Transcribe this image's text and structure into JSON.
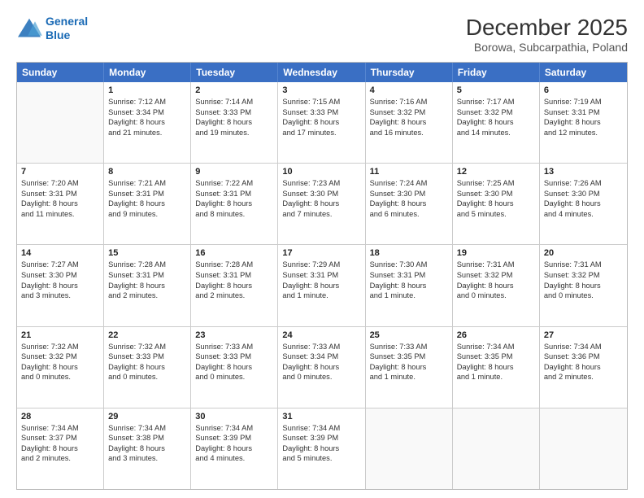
{
  "logo": {
    "line1": "General",
    "line2": "Blue"
  },
  "header": {
    "month": "December 2025",
    "location": "Borowa, Subcarpathia, Poland"
  },
  "weekdays": [
    "Sunday",
    "Monday",
    "Tuesday",
    "Wednesday",
    "Thursday",
    "Friday",
    "Saturday"
  ],
  "rows": [
    [
      {
        "day": "",
        "lines": []
      },
      {
        "day": "1",
        "lines": [
          "Sunrise: 7:12 AM",
          "Sunset: 3:34 PM",
          "Daylight: 8 hours",
          "and 21 minutes."
        ]
      },
      {
        "day": "2",
        "lines": [
          "Sunrise: 7:14 AM",
          "Sunset: 3:33 PM",
          "Daylight: 8 hours",
          "and 19 minutes."
        ]
      },
      {
        "day": "3",
        "lines": [
          "Sunrise: 7:15 AM",
          "Sunset: 3:33 PM",
          "Daylight: 8 hours",
          "and 17 minutes."
        ]
      },
      {
        "day": "4",
        "lines": [
          "Sunrise: 7:16 AM",
          "Sunset: 3:32 PM",
          "Daylight: 8 hours",
          "and 16 minutes."
        ]
      },
      {
        "day": "5",
        "lines": [
          "Sunrise: 7:17 AM",
          "Sunset: 3:32 PM",
          "Daylight: 8 hours",
          "and 14 minutes."
        ]
      },
      {
        "day": "6",
        "lines": [
          "Sunrise: 7:19 AM",
          "Sunset: 3:31 PM",
          "Daylight: 8 hours",
          "and 12 minutes."
        ]
      }
    ],
    [
      {
        "day": "7",
        "lines": [
          "Sunrise: 7:20 AM",
          "Sunset: 3:31 PM",
          "Daylight: 8 hours",
          "and 11 minutes."
        ]
      },
      {
        "day": "8",
        "lines": [
          "Sunrise: 7:21 AM",
          "Sunset: 3:31 PM",
          "Daylight: 8 hours",
          "and 9 minutes."
        ]
      },
      {
        "day": "9",
        "lines": [
          "Sunrise: 7:22 AM",
          "Sunset: 3:31 PM",
          "Daylight: 8 hours",
          "and 8 minutes."
        ]
      },
      {
        "day": "10",
        "lines": [
          "Sunrise: 7:23 AM",
          "Sunset: 3:30 PM",
          "Daylight: 8 hours",
          "and 7 minutes."
        ]
      },
      {
        "day": "11",
        "lines": [
          "Sunrise: 7:24 AM",
          "Sunset: 3:30 PM",
          "Daylight: 8 hours",
          "and 6 minutes."
        ]
      },
      {
        "day": "12",
        "lines": [
          "Sunrise: 7:25 AM",
          "Sunset: 3:30 PM",
          "Daylight: 8 hours",
          "and 5 minutes."
        ]
      },
      {
        "day": "13",
        "lines": [
          "Sunrise: 7:26 AM",
          "Sunset: 3:30 PM",
          "Daylight: 8 hours",
          "and 4 minutes."
        ]
      }
    ],
    [
      {
        "day": "14",
        "lines": [
          "Sunrise: 7:27 AM",
          "Sunset: 3:30 PM",
          "Daylight: 8 hours",
          "and 3 minutes."
        ]
      },
      {
        "day": "15",
        "lines": [
          "Sunrise: 7:28 AM",
          "Sunset: 3:31 PM",
          "Daylight: 8 hours",
          "and 2 minutes."
        ]
      },
      {
        "day": "16",
        "lines": [
          "Sunrise: 7:28 AM",
          "Sunset: 3:31 PM",
          "Daylight: 8 hours",
          "and 2 minutes."
        ]
      },
      {
        "day": "17",
        "lines": [
          "Sunrise: 7:29 AM",
          "Sunset: 3:31 PM",
          "Daylight: 8 hours",
          "and 1 minute."
        ]
      },
      {
        "day": "18",
        "lines": [
          "Sunrise: 7:30 AM",
          "Sunset: 3:31 PM",
          "Daylight: 8 hours",
          "and 1 minute."
        ]
      },
      {
        "day": "19",
        "lines": [
          "Sunrise: 7:31 AM",
          "Sunset: 3:32 PM",
          "Daylight: 8 hours",
          "and 0 minutes."
        ]
      },
      {
        "day": "20",
        "lines": [
          "Sunrise: 7:31 AM",
          "Sunset: 3:32 PM",
          "Daylight: 8 hours",
          "and 0 minutes."
        ]
      }
    ],
    [
      {
        "day": "21",
        "lines": [
          "Sunrise: 7:32 AM",
          "Sunset: 3:32 PM",
          "Daylight: 8 hours",
          "and 0 minutes."
        ]
      },
      {
        "day": "22",
        "lines": [
          "Sunrise: 7:32 AM",
          "Sunset: 3:33 PM",
          "Daylight: 8 hours",
          "and 0 minutes."
        ]
      },
      {
        "day": "23",
        "lines": [
          "Sunrise: 7:33 AM",
          "Sunset: 3:33 PM",
          "Daylight: 8 hours",
          "and 0 minutes."
        ]
      },
      {
        "day": "24",
        "lines": [
          "Sunrise: 7:33 AM",
          "Sunset: 3:34 PM",
          "Daylight: 8 hours",
          "and 0 minutes."
        ]
      },
      {
        "day": "25",
        "lines": [
          "Sunrise: 7:33 AM",
          "Sunset: 3:35 PM",
          "Daylight: 8 hours",
          "and 1 minute."
        ]
      },
      {
        "day": "26",
        "lines": [
          "Sunrise: 7:34 AM",
          "Sunset: 3:35 PM",
          "Daylight: 8 hours",
          "and 1 minute."
        ]
      },
      {
        "day": "27",
        "lines": [
          "Sunrise: 7:34 AM",
          "Sunset: 3:36 PM",
          "Daylight: 8 hours",
          "and 2 minutes."
        ]
      }
    ],
    [
      {
        "day": "28",
        "lines": [
          "Sunrise: 7:34 AM",
          "Sunset: 3:37 PM",
          "Daylight: 8 hours",
          "and 2 minutes."
        ]
      },
      {
        "day": "29",
        "lines": [
          "Sunrise: 7:34 AM",
          "Sunset: 3:38 PM",
          "Daylight: 8 hours",
          "and 3 minutes."
        ]
      },
      {
        "day": "30",
        "lines": [
          "Sunrise: 7:34 AM",
          "Sunset: 3:39 PM",
          "Daylight: 8 hours",
          "and 4 minutes."
        ]
      },
      {
        "day": "31",
        "lines": [
          "Sunrise: 7:34 AM",
          "Sunset: 3:39 PM",
          "Daylight: 8 hours",
          "and 5 minutes."
        ]
      },
      {
        "day": "",
        "lines": []
      },
      {
        "day": "",
        "lines": []
      },
      {
        "day": "",
        "lines": []
      }
    ]
  ]
}
